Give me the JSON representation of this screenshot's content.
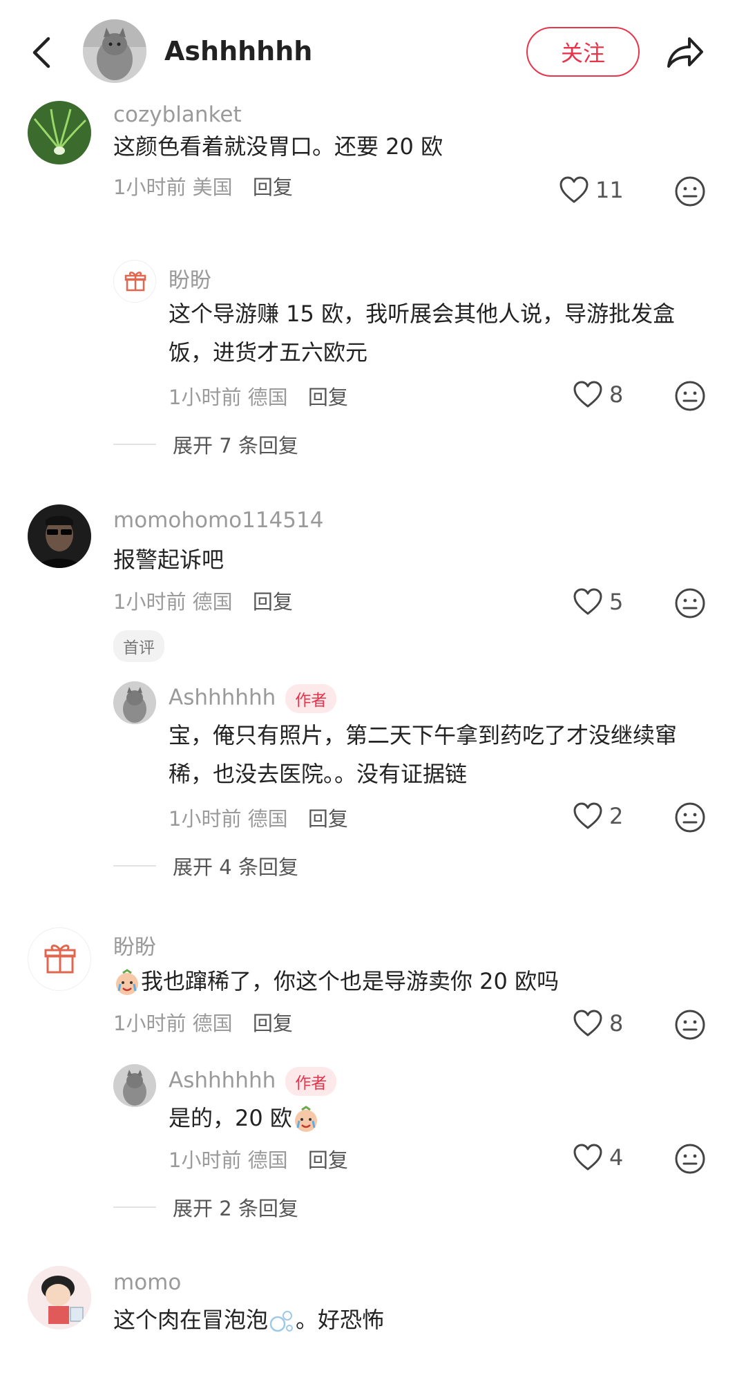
{
  "header": {
    "username": "Ashhhhhh",
    "follow_label": "关注"
  },
  "comments": [
    {
      "username": "cozyblanket",
      "content": "这颜色看着就没胃口。还要 20 欧",
      "time": "1小时前",
      "location": "美国",
      "reply_label": "回复",
      "likes": "11",
      "replies": [
        {
          "username": "盼盼",
          "content": "这个导游赚 15 欧，我听展会其他人说，导游批发盒饭，进货才五六欧元",
          "time": "1小时前",
          "location": "德国",
          "reply_label": "回复",
          "likes": "8"
        }
      ],
      "expand_label": "展开 7 条回复"
    },
    {
      "username": "momohomo114514",
      "content": "报警起诉吧",
      "time": "1小时前",
      "location": "德国",
      "reply_label": "回复",
      "likes": "5",
      "first_tag": "首评",
      "replies": [
        {
          "username": "Ashhhhhh",
          "author_tag": "作者",
          "content": "宝，俺只有照片，第二天下午拿到药吃了才没继续窜稀，也没去医院。。没有证据链",
          "time": "1小时前",
          "location": "德国",
          "reply_label": "回复",
          "likes": "2"
        }
      ],
      "expand_label": "展开 4 条回复"
    },
    {
      "username": "盼盼",
      "content": "我也蹿稀了，你这个也是导游卖你 20 欧吗",
      "time": "1小时前",
      "location": "德国",
      "reply_label": "回复",
      "likes": "8",
      "replies": [
        {
          "username": "Ashhhhhh",
          "author_tag": "作者",
          "content": "是的，20 欧",
          "time": "1小时前",
          "location": "德国",
          "reply_label": "回复",
          "likes": "4"
        }
      ],
      "expand_label": "展开 2 条回复"
    },
    {
      "username": "momo",
      "content_before": "这个肉在冒泡泡",
      "content_after": "。好恐怖"
    }
  ],
  "colors": {
    "accent": "#e8344a",
    "muted_text": "#9a9a9a",
    "main_text": "#222222"
  },
  "icons": {
    "back": "chevron-left-icon",
    "share": "share-arrow-icon",
    "like": "heart-outline-icon",
    "emoji": "neutral-face-icon",
    "gift": "gift-icon",
    "crying_emoji": "crying-face-emoji",
    "bubbles": "bubbles-emoji"
  }
}
